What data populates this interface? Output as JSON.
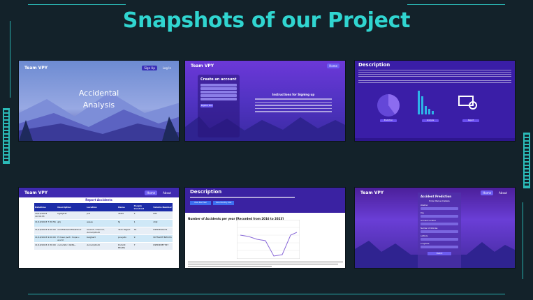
{
  "slide": {
    "title": "Snapshots of our Project"
  },
  "colors": {
    "background": "#13222a",
    "accent": "#30d5d0",
    "brand_purple": "#3f2ab0"
  },
  "thumbnails": [
    {
      "brand": "Team VPY",
      "nav": [
        "Sign Up",
        "Log In"
      ],
      "hero_line1": "Accidental",
      "hero_line2": "Analysis"
    },
    {
      "brand": "Team VPY",
      "nav": [
        "Home"
      ],
      "form_title": "Create an account",
      "instructions_title": "Instructions for Signing up",
      "submit_label": "Register Now"
    },
    {
      "title": "Description",
      "buttons": [
        "Prediction",
        "Analysis",
        "Report"
      ]
    },
    {
      "brand": "Team VPY",
      "nav": [
        "Home",
        "About"
      ],
      "table_title": "Report Accidents",
      "columns": [
        "Datetime",
        "Description",
        "Location",
        "Name",
        "People Involved",
        "Vehicle Number"
      ],
      "rows": [
        [
          "10/12/2023 10:30:33",
          "hghfjfvst",
          "pvf",
          "dfdfd",
          "2",
          "hfhi"
        ],
        [
          "11/10/2023 7:30:56",
          "ghj",
          "eases",
          "fg",
          "1",
          "vhjk"
        ],
        [
          "11/10/2023 9:00:00",
          "sbrdfhkdsbrdfhkefdnuf",
          "Guwah, Chennai, Accumptnoti",
          "Yash Rajput",
          "34",
          "09HDR3A471"
        ],
        [
          "11/10/2023 9:00:00",
          "Hi heei pvvt i hope u evvnt",
          "beighert",
          "pvs.jato",
          "9",
          "9hTfsxhfhTsfhhhh"
        ],
        [
          "11/10/2023 2:30:00",
          "cennmlhc dbdfa...",
          "Accumptnoti",
          "Pumnit Bhatta",
          "7",
          "09HDR3E7767"
        ]
      ]
    },
    {
      "title": "Description",
      "buttons": [
        "View Past Year",
        "View Monthly Stat"
      ],
      "chart_label": "Number of Accidents per year [Recorded from 2016 to 2023]"
    },
    {
      "brand": "Team VPY",
      "nav": [
        "Home",
        "About"
      ],
      "panel_title": "Accident Prediction",
      "panel_subtitle": "Enter Below Details",
      "fields": [
        "Weather",
        "Day",
        "Accident Location",
        "Number of Vehicles",
        "Latitude",
        "Longitude"
      ],
      "submit_label": "Predict"
    }
  ]
}
